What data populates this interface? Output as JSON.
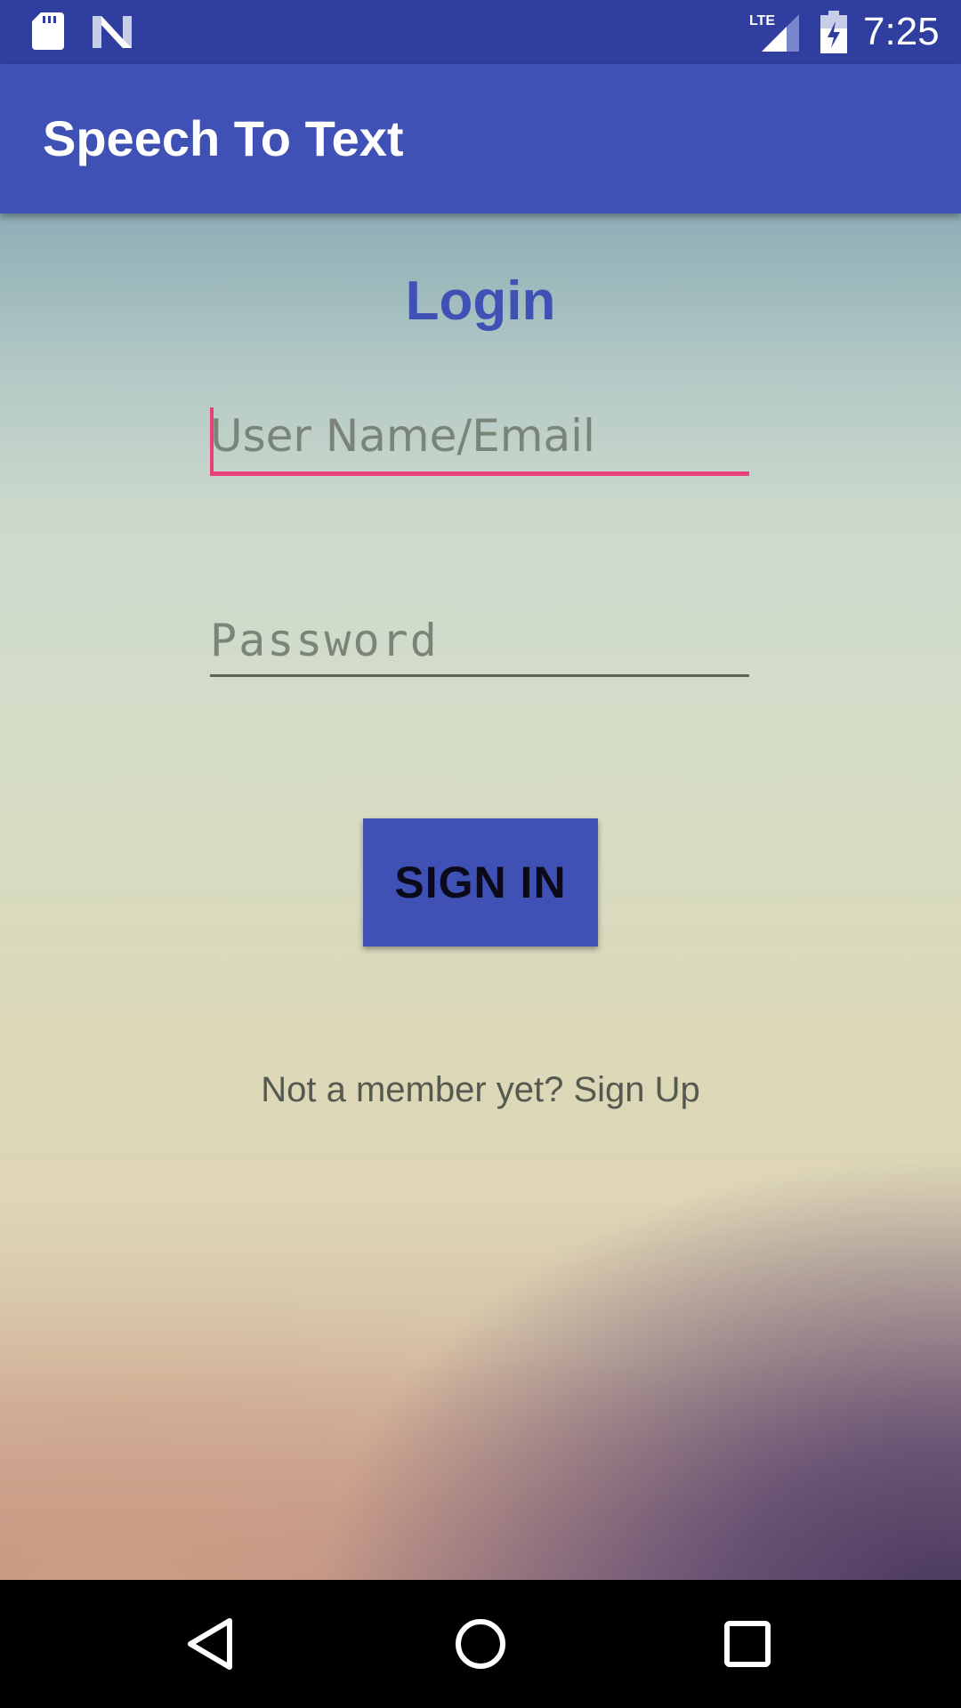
{
  "status_bar": {
    "time": "7:25",
    "network_label": "LTE",
    "icons": [
      "sd-card-icon",
      "n-logo-icon",
      "lte-signal-icon",
      "battery-charging-icon"
    ]
  },
  "app_bar": {
    "title": "Speech To Text",
    "color": "#3F51B5"
  },
  "login": {
    "heading": "Login",
    "username_placeholder": "User Name/Email",
    "username_value": "",
    "password_placeholder": "Password",
    "password_value": "",
    "signin_label": "SIGN IN",
    "signup_text": "Not a member yet? Sign Up"
  },
  "colors": {
    "primary": "#3F51B5",
    "primary_dark": "#303F9F",
    "accent": "#E8407A"
  },
  "nav_bar": {
    "buttons": [
      "back-icon",
      "home-icon",
      "recents-icon"
    ]
  }
}
